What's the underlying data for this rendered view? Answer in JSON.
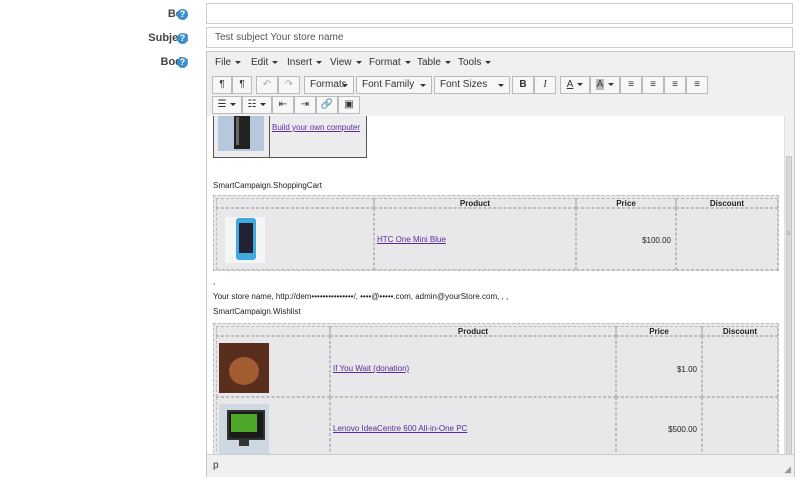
{
  "form": {
    "bcc_label": "Bcc",
    "bcc_value": "",
    "subject_label": "Subject",
    "subject_value": "Test subject Your store name",
    "body_label": "Body"
  },
  "menubar": [
    "File",
    "Edit",
    "Insert",
    "View",
    "Format",
    "Table",
    "Tools"
  ],
  "toolbar": {
    "formats": "Formats",
    "font_family": "Font Family",
    "font_sizes": "Font Sizes",
    "bold": "B",
    "italic": "I",
    "text_color": "A",
    "bg_color": "A"
  },
  "content": {
    "build_link": "Build your own computer",
    "shopping_cart_token": "SmartCampaign.ShoppingCart",
    "cart_headers": [
      "Product",
      "Price",
      "Discount"
    ],
    "cart_rows": [
      {
        "product": "HTC One Mini Blue",
        "price": "$100.00",
        "discount": ""
      }
    ],
    "comma_line": ",",
    "store_line": "Your store name, http://dem•••••••••••••••/, ••••@•••••.com, admin@yourStore.com, , ,",
    "wishlist_token": "SmartCampaign.Wishlist",
    "wishlist_headers": [
      "Product",
      "Price",
      "Discount"
    ],
    "wishlist_rows": [
      {
        "product": "If You Wait (donation)",
        "price": "$1.00",
        "discount": ""
      },
      {
        "product": "Lenovo IdeaCentre 600 All-in-One PC",
        "price": "$500.00",
        "discount": ""
      }
    ]
  },
  "statusbar": {
    "path": "p"
  },
  "colors": {
    "help_icon": "#3a8fd0",
    "link": "#5a2d9a",
    "toolbar_bg": "#f0f0f0"
  }
}
